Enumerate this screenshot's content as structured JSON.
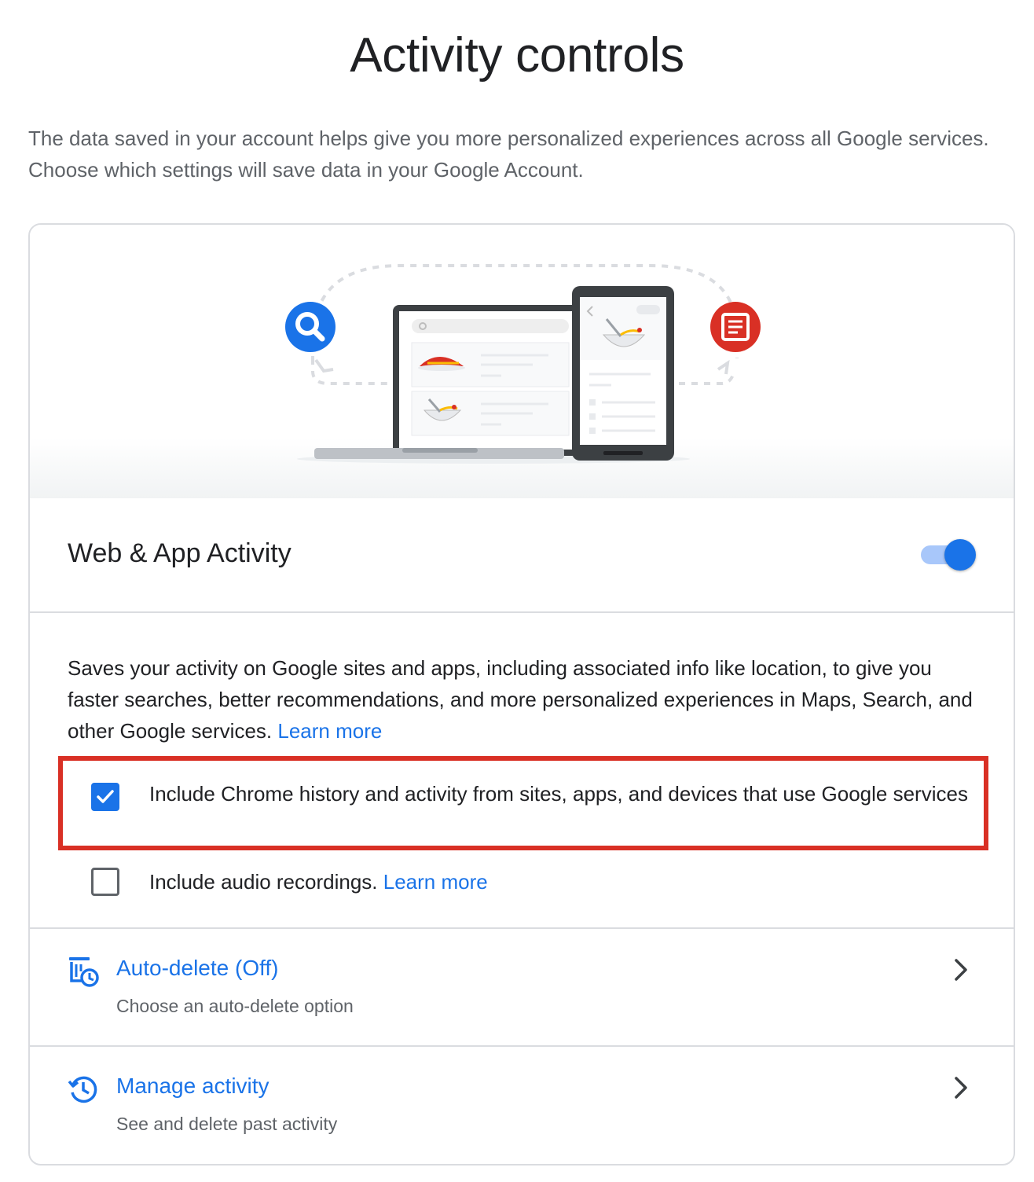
{
  "page": {
    "title": "Activity controls",
    "intro": "The data saved in your account helps give you more personalized experiences across all Google services. Choose which settings will save data in your Google Account."
  },
  "section": {
    "title": "Web & App Activity",
    "toggle_on": true,
    "description": "Saves your activity on Google sites and apps, including associated info like location, to give you faster searches, better recommendations, and more personalized experiences in Maps, Search, and other Google services.",
    "description_link": "Learn more"
  },
  "options": [
    {
      "label": "Include Chrome history and activity from sites, apps, and devices that use Google services",
      "checked": true,
      "highlighted": true
    },
    {
      "label": "Include audio recordings.",
      "link": "Learn more",
      "checked": false,
      "highlighted": false
    }
  ],
  "nav": [
    {
      "title": "Auto-delete (Off)",
      "subtitle": "Choose an auto-delete option",
      "icon": "auto-delete-icon"
    },
    {
      "title": "Manage activity",
      "subtitle": "See and delete past activity",
      "icon": "history-icon"
    }
  ],
  "colors": {
    "accent": "#1a73e8",
    "highlight": "#d93025",
    "search_badge": "#1a73e8",
    "doc_badge": "#d93025"
  }
}
